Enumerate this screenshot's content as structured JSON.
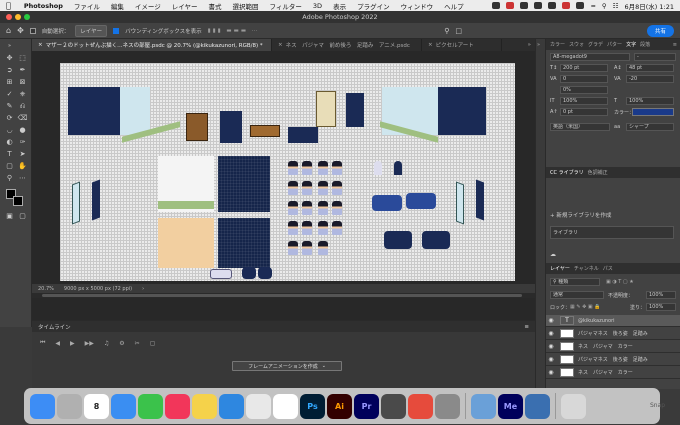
{
  "menubar": {
    "app": "Photoshop",
    "items": [
      "ファイル",
      "編集",
      "イメージ",
      "レイヤー",
      "書式",
      "選択範囲",
      "フィルター",
      "3D",
      "表示",
      "プラグイン",
      "ウィンドウ",
      "ヘルプ"
    ],
    "clock": "6月8日(水) 1:21"
  },
  "window": {
    "title": "Adobe Photoshop 2022"
  },
  "options": {
    "autoselect": "自動選択：",
    "layer_dropdown": "レイヤー",
    "bbox": "バウンディングボックスを表示",
    "share": "共有"
  },
  "tabs": [
    {
      "label": "マザー２のドットぜんぶ描く…ネスの部屋.psdc @ 20.7% (@kikukazunori, RGB/8) *",
      "active": true
    },
    {
      "label": "ネス　パジャマ　前め後ろ　足踏み　アニメ.psdc",
      "active": false
    },
    {
      "label": "ピクセルアート",
      "active": false
    }
  ],
  "status": {
    "zoom": "20.7%",
    "size": "9000 px x 5000 px (72 ppi)"
  },
  "timeline": {
    "title": "タイムライン",
    "create_button": "フレームアニメーションを作成"
  },
  "right": {
    "top_tabs": [
      "カラー",
      "スウォ",
      "グラデ",
      "パター",
      "文字",
      "段落"
    ],
    "font": "A8-megadot9",
    "size": "200 pt",
    "leading": "48 pt",
    "tracking": "0",
    "kerning": "-20",
    "tsume": "0%",
    "vscale": "100%",
    "hscale": "100%",
    "baseline": "0 pt",
    "color_label": "カラー：",
    "lang": "英語（米国）",
    "sharp": "シャープ",
    "lib_tabs": [
      "CC ライブラリ",
      "色調補正"
    ],
    "new_lib": "新規ライブラリを作成",
    "lib_name": "ライブラリ",
    "layer_tabs": [
      "レイヤー",
      "チャンネル",
      "パス"
    ],
    "kind": "種類",
    "blend": "通常",
    "opacity_label": "不透明度：",
    "opacity": "100%",
    "lock_label": "ロック：",
    "fill_label": "塗り：",
    "fill": "100%",
    "layers": [
      {
        "name": "@kikukazunori",
        "selected": true,
        "type": "T"
      },
      {
        "name": "パジャマネス　後ろ姿　足踏み",
        "selected": false
      },
      {
        "name": "ネス　パジャマ　カラー",
        "selected": false
      },
      {
        "name": "パジャマネス　後ろ姿　足踏み",
        "selected": false
      },
      {
        "name": "ネス　パジャマ　カラー",
        "selected": false
      }
    ]
  },
  "dock": [
    {
      "name": "finder-icon",
      "label": "",
      "color": "#3d8df5"
    },
    {
      "name": "launchpad-icon",
      "label": "",
      "color": "#b0b0b0"
    },
    {
      "name": "calendar-icon",
      "label": "8",
      "color": "#ffffff"
    },
    {
      "name": "mail-icon",
      "label": "",
      "color": "#3a8ef2"
    },
    {
      "name": "messages-icon",
      "label": "",
      "color": "#3bc24b"
    },
    {
      "name": "music-icon",
      "label": "",
      "color": "#f2365a"
    },
    {
      "name": "notes-icon",
      "label": "",
      "color": "#f5d24a"
    },
    {
      "name": "safari-icon",
      "label": "",
      "color": "#2e87e0"
    },
    {
      "name": "chrome-icon",
      "label": "",
      "color": "#e8e8e8"
    },
    {
      "name": "evernote-icon",
      "label": "",
      "color": "#ffffff"
    },
    {
      "name": "photoshop-icon",
      "label": "Ps",
      "color": "#001d34"
    },
    {
      "name": "illustrator-icon",
      "label": "Ai",
      "color": "#330000"
    },
    {
      "name": "premiere-icon",
      "label": "Pr",
      "color": "#00005b"
    },
    {
      "name": "utility-icon",
      "label": "",
      "color": "#4a4a4a"
    },
    {
      "name": "creative-cloud-icon",
      "label": "",
      "color": "#e64b3c"
    },
    {
      "name": "system-preferences-icon",
      "label": "",
      "color": "#8a8a8a"
    },
    {
      "name": "preview-icon",
      "label": "",
      "color": "#6aa0d8"
    },
    {
      "name": "media-encoder-icon",
      "label": "Me",
      "color": "#00005b"
    },
    {
      "name": "quicktime-icon",
      "label": "",
      "color": "#3a6fb0"
    },
    {
      "name": "trash-icon",
      "label": "",
      "color": "#d8d8d8"
    }
  ],
  "watermark": "Snap"
}
